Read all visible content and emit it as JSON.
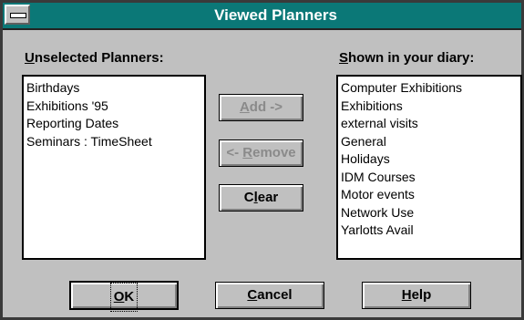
{
  "window": {
    "title": "Viewed Planners"
  },
  "unselected": {
    "label_mnemonic": "U",
    "label_rest": "nselected Planners:",
    "items": [
      "Birthdays",
      "Exhibitions '95",
      "Reporting Dates",
      "Seminars : TimeSheet"
    ]
  },
  "shown": {
    "label_mnemonic": "S",
    "label_rest": "hown in your diary:",
    "items": [
      "Computer Exhibitions",
      "Exhibitions",
      "external visits",
      "General",
      "Holidays",
      "IDM Courses",
      "Motor events",
      "Network Use",
      "Yarlotts Avail"
    ]
  },
  "buttons": {
    "add": {
      "mnemonic": "A",
      "rest": "dd ->"
    },
    "remove": {
      "pre": "<- ",
      "mnemonic": "R",
      "rest": "emove"
    },
    "clear": {
      "pre": "C",
      "mnemonic": "l",
      "rest": "ear"
    },
    "ok": {
      "mnemonic": "O",
      "rest": "K"
    },
    "cancel": {
      "mnemonic": "C",
      "rest": "ancel"
    },
    "help": {
      "mnemonic": "H",
      "rest": "elp"
    }
  },
  "icons": {
    "system_menu": "system-menu-icon"
  },
  "colors": {
    "titlebar": "#0b7877",
    "face": "#c0c0c0",
    "disabled_text": "#8a8a8a"
  }
}
